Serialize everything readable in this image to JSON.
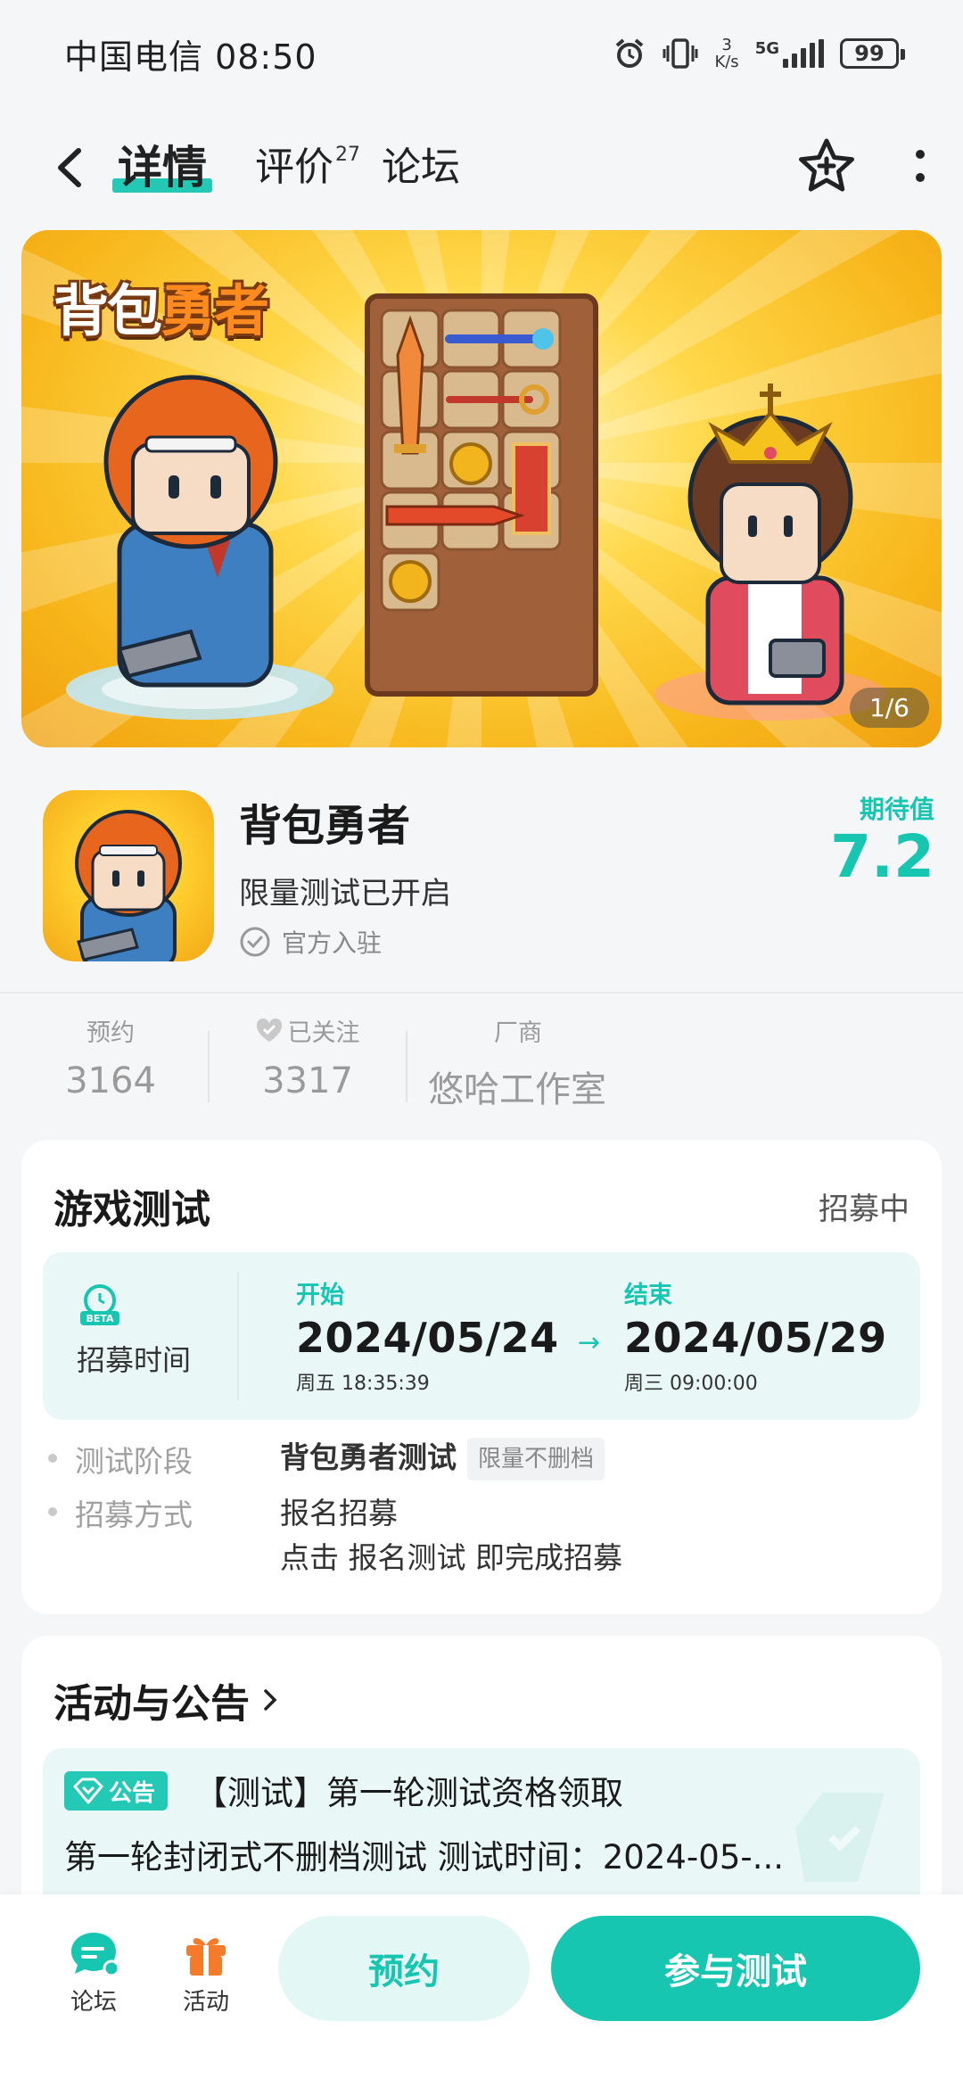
{
  "status_bar": {
    "carrier_time": "中国电信 08:50",
    "net_speed_value": "3",
    "net_speed_unit": "K/s",
    "network": "5G",
    "battery": "99"
  },
  "nav": {
    "tabs": [
      {
        "label": "详情",
        "active": true
      },
      {
        "label": "评价",
        "count": "27"
      },
      {
        "label": "论坛"
      }
    ]
  },
  "banner": {
    "logo_text_a": "背包",
    "logo_text_b": "勇者",
    "counter": "1/6"
  },
  "app": {
    "name": "背包勇者",
    "status": "限量测试已开启",
    "official": "官方入驻",
    "score_label": "期待值",
    "score_value": "7.2"
  },
  "stats": [
    {
      "label": "预约",
      "value": "3164"
    },
    {
      "label": "已关注",
      "value": "3317"
    },
    {
      "label": "厂商",
      "value": "悠哈工作室"
    }
  ],
  "test": {
    "title": "游戏测试",
    "status": "招募中",
    "period_label": "招募时间",
    "start_label": "开始",
    "start_date": "2024/05/24",
    "start_time": "周五  18:35:39",
    "end_label": "结束",
    "end_date": "2024/05/29",
    "end_time": "周三  09:00:00",
    "stage_key": "测试阶段",
    "stage_value": "背包勇者测试",
    "stage_chip": "限量不删档",
    "method_key": "招募方式",
    "method_value": "报名招募",
    "method_note_a": "点击 ",
    "method_note_b": "报名测试",
    "method_note_c": " 即完成招募"
  },
  "events": {
    "title": "活动与公告",
    "badge": "公告",
    "notice_title": "【测试】第一轮测试资格领取",
    "notice_sub": "第一轮封闭式不删档测试 测试时间：2024-05-..."
  },
  "bottom": {
    "forum": "论坛",
    "activity": "活动",
    "reserve": "预约",
    "join": "参与测试"
  },
  "colors": {
    "accent": "#17c6b1",
    "accent_light": "#e9f8f6",
    "activity_orange": "#f57a2a"
  }
}
